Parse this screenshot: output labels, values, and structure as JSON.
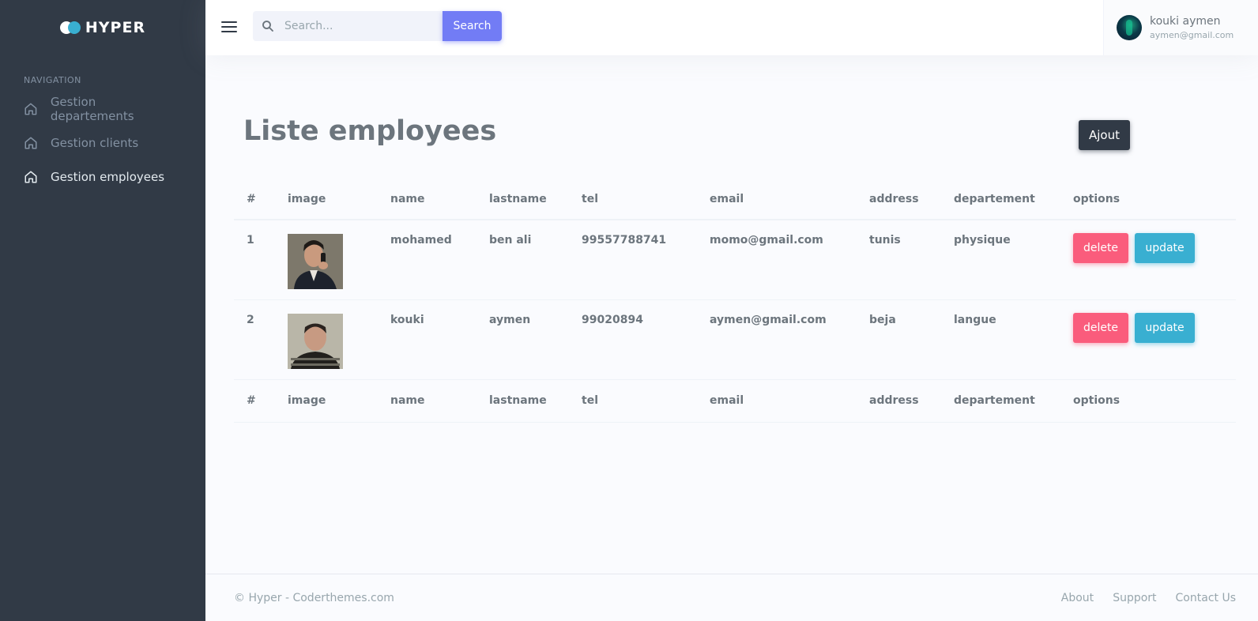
{
  "brand": {
    "name": "HYPER"
  },
  "sidebar": {
    "section_title": "NAVIGATION",
    "items": [
      {
        "label": "Gestion departements",
        "icon": "home-icon",
        "active": false
      },
      {
        "label": "Gestion clients",
        "icon": "home-icon",
        "active": false
      },
      {
        "label": "Gestion employees",
        "icon": "home-icon",
        "active": true
      }
    ]
  },
  "topbar": {
    "search_placeholder": "Search...",
    "search_button": "Search",
    "user": {
      "name": "kouki aymen",
      "email": "aymen@gmail.com"
    }
  },
  "main": {
    "title": "Liste employees",
    "add_button": "Ajout",
    "table": {
      "columns": [
        "#",
        "image",
        "name",
        "lastname",
        "tel",
        "email",
        "address",
        "departement",
        "options"
      ],
      "rows": [
        {
          "id": "1",
          "name": "mohamed",
          "lastname": "ben ali",
          "tel": "99557788741",
          "email": "momo@gmail.com",
          "address": "tunis",
          "departement": "physique",
          "delete_label": "delete",
          "update_label": "update"
        },
        {
          "id": "2",
          "name": "kouki",
          "lastname": "aymen",
          "tel": "99020894",
          "email": "aymen@gmail.com",
          "address": "beja",
          "departement": "langue",
          "delete_label": "delete",
          "update_label": "update"
        }
      ]
    }
  },
  "footer": {
    "copyright": "© Hyper - Coderthemes.com",
    "links": [
      "About",
      "Support",
      "Contact Us"
    ]
  },
  "colors": {
    "sidebar_bg": "#313a46",
    "primary": "#727cf5",
    "danger": "#fa5c7c",
    "info": "#39afd1",
    "dark": "#313a46"
  }
}
